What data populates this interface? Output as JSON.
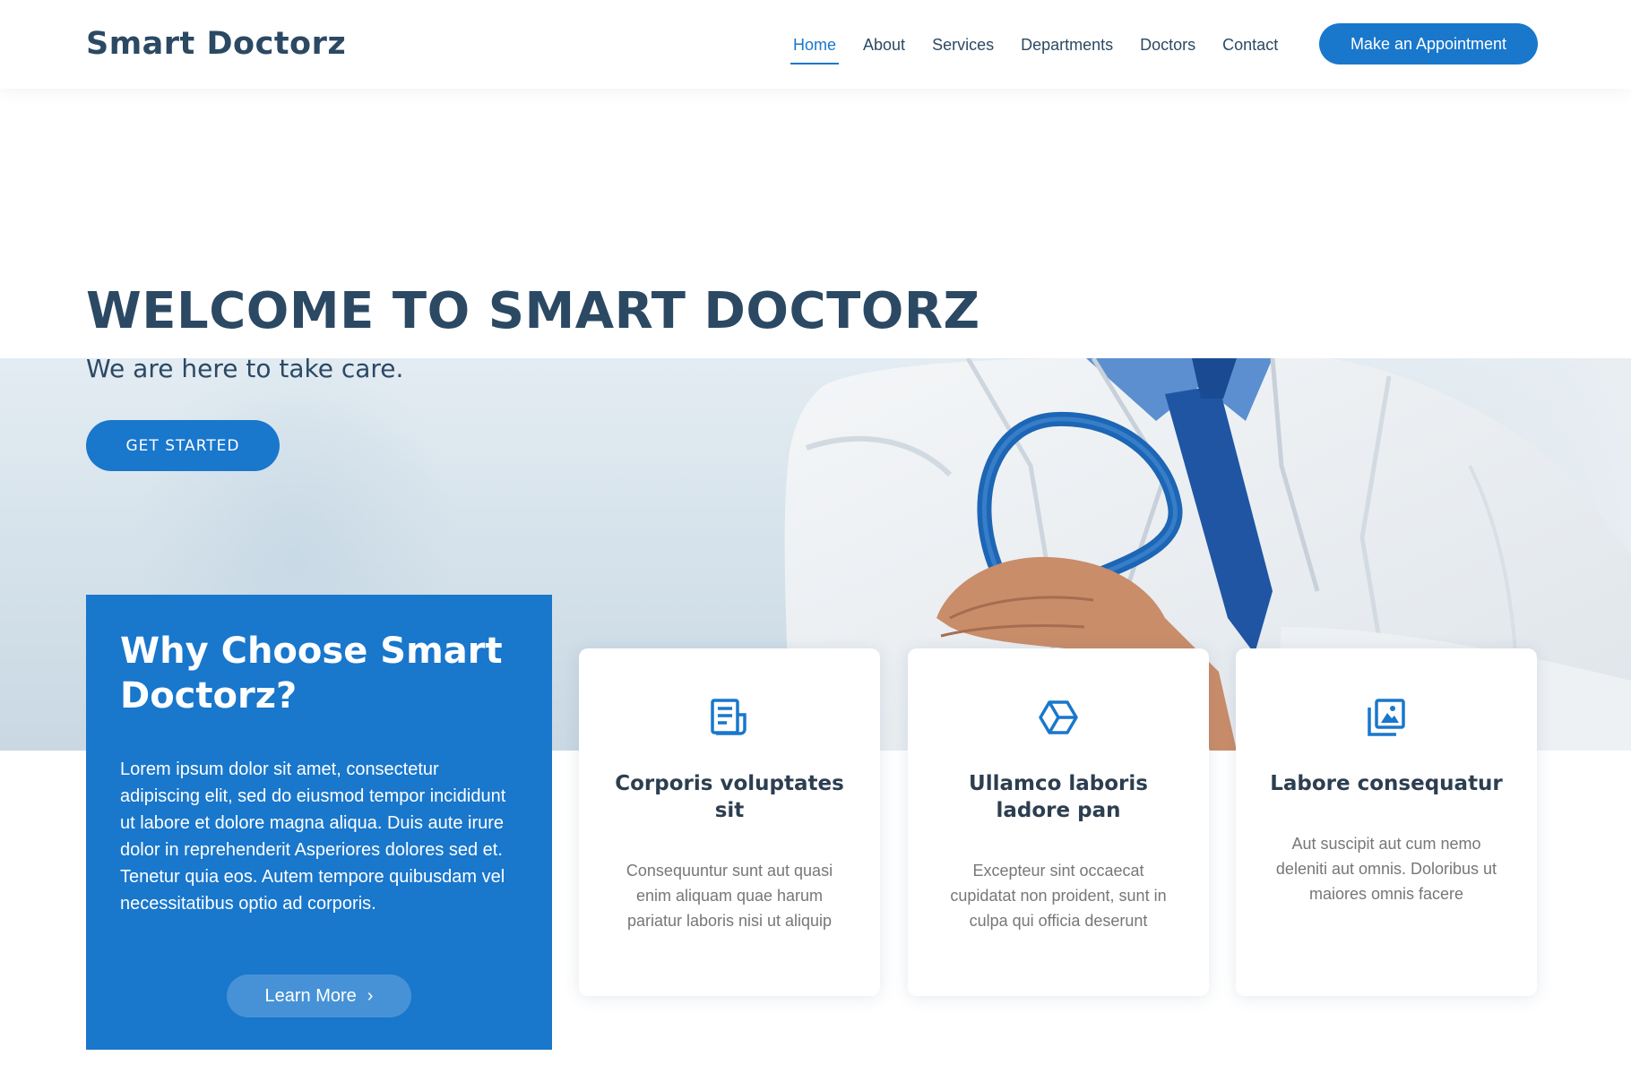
{
  "header": {
    "logo": "Smart Doctorz",
    "nav": [
      "Home",
      "About",
      "Services",
      "Departments",
      "Doctors",
      "Contact"
    ],
    "active_nav": "Home",
    "cta": "Make an Appointment"
  },
  "hero": {
    "title": "WELCOME TO SMART DOCTORZ",
    "subtitle": "We are here to take care.",
    "button": "GET STARTED"
  },
  "why": {
    "title": "Why Choose Smart Doctorz?",
    "text": "Lorem ipsum dolor sit amet, consectetur adipiscing elit, sed do eiusmod tempor incididunt ut labore et dolore magna aliqua. Duis aute irure dolor in reprehenderit Asperiores dolores sed et. Tenetur quia eos. Autem tempore quibusdam vel necessitatibus optio ad corporis.",
    "button": "Learn More",
    "button_icon": "chevron-right-icon"
  },
  "cards": [
    {
      "icon": "receipt-icon",
      "title": "Corporis voluptates sit",
      "text": "Consequuntur sunt aut quasi enim aliquam quae harum pariatur laboris nisi ut aliquip"
    },
    {
      "icon": "cube-icon",
      "title": "Ullamco laboris ladore pan",
      "text": "Excepteur sint occaecat cupidatat non proident, sunt in culpa qui officia deserunt"
    },
    {
      "icon": "images-icon",
      "title": "Labore consequatur",
      "text": "Aut suscipit aut cum nemo deleniti aut omnis. Doloribus ut maiores omnis facere"
    }
  ],
  "colors": {
    "primary": "#1977cc",
    "heading": "#2c4964",
    "card_title": "#2c3e50",
    "card_text": "#777777"
  }
}
